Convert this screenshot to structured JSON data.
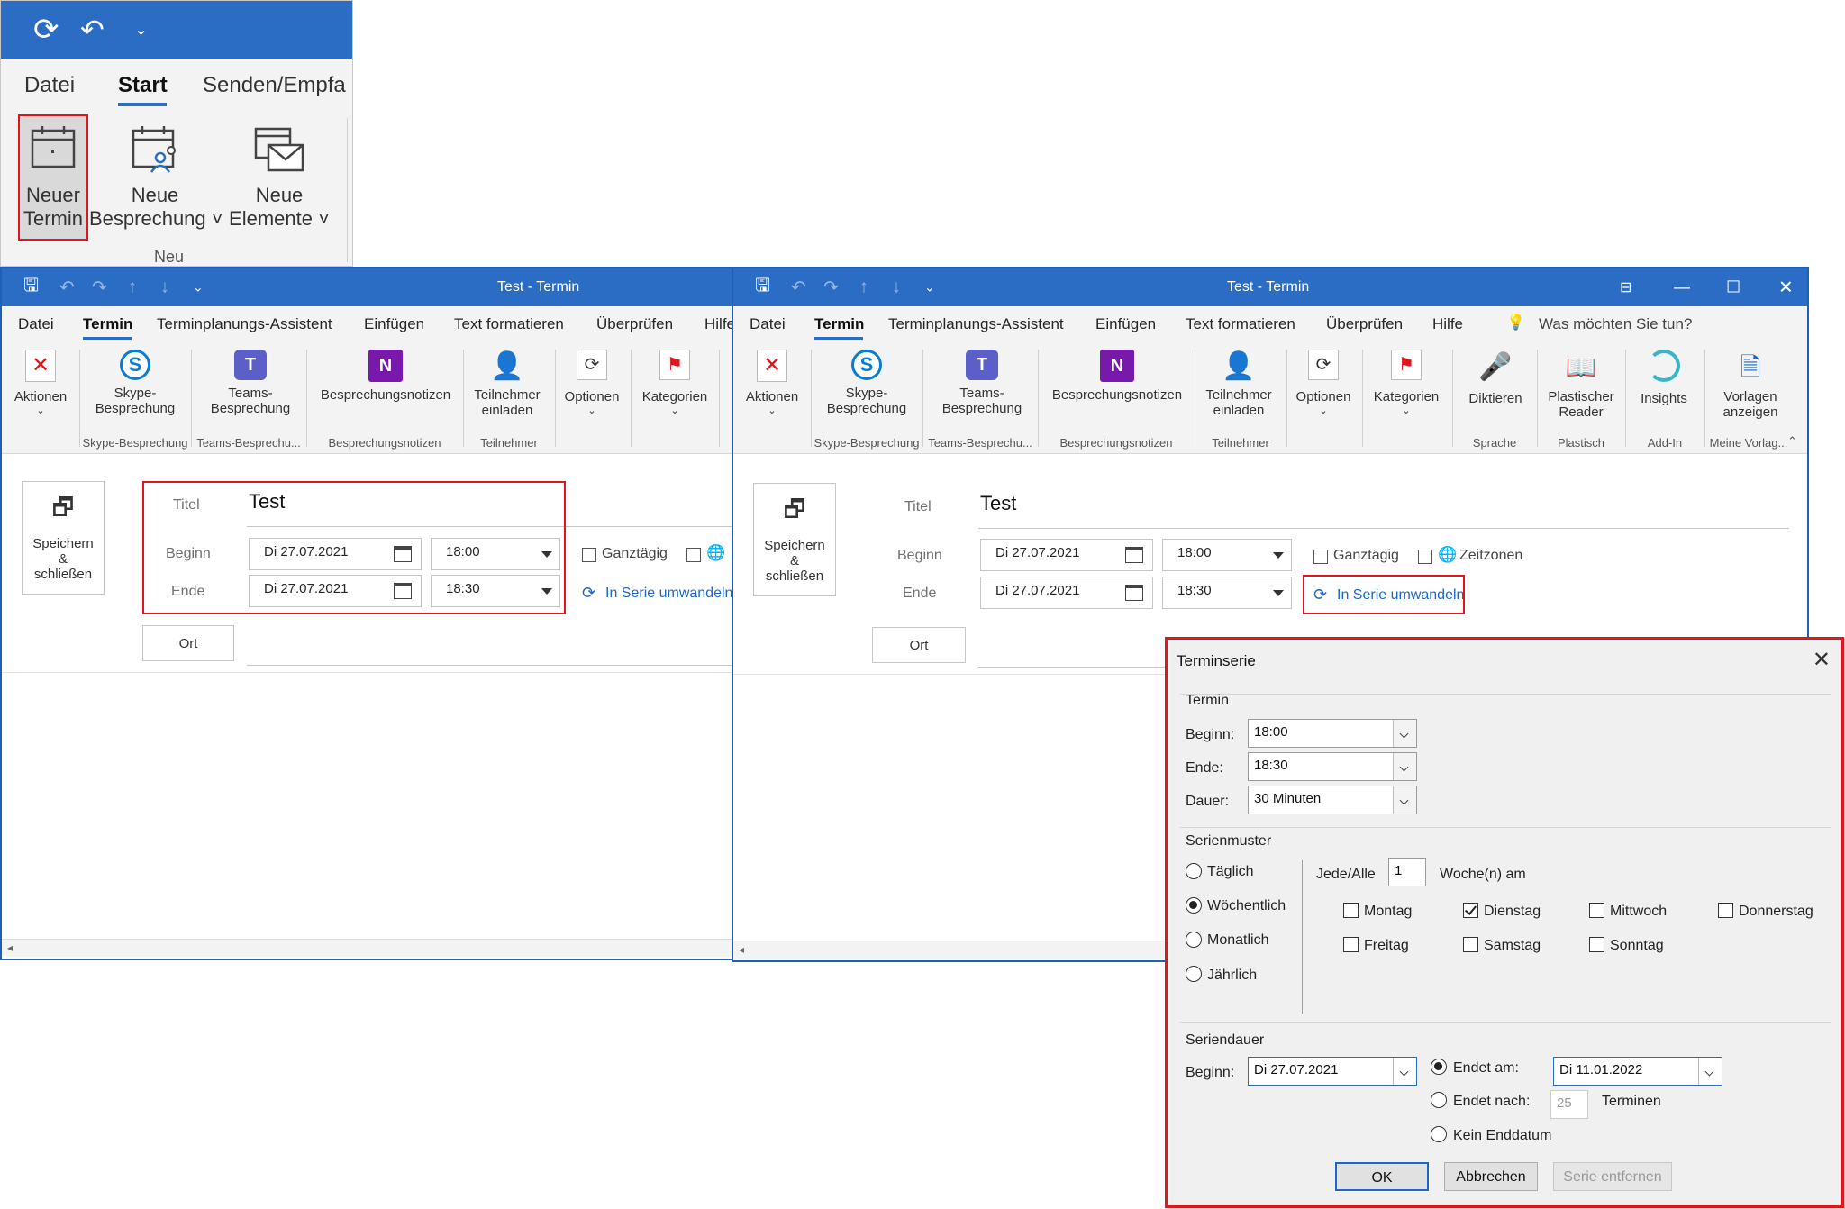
{
  "snippet": {
    "tabs": [
      "Datei",
      "Start",
      "Senden/Empfa"
    ],
    "buttons": [
      {
        "line1": "Neuer",
        "line2": "Termin"
      },
      {
        "line1": "Neue",
        "line2": "Besprechung ˅"
      },
      {
        "line1": "Neue",
        "line2": "Elemente ˅"
      }
    ],
    "group_label": "Neu"
  },
  "win1": {
    "title": "Test  -  Termin",
    "menu": [
      "Datei",
      "Termin",
      "Terminplanungs-Assistent",
      "Einfügen",
      "Text formatieren",
      "Überprüfen",
      "Hilfe"
    ],
    "ribbon": {
      "aktionen": "Aktionen",
      "skype": [
        "Skype-",
        "Besprechung"
      ],
      "teams": [
        "Teams-",
        "Besprechung"
      ],
      "notizen": "Besprechungsnotizen",
      "teilnehmer": [
        "Teilnehmer",
        "einladen"
      ],
      "optionen": "Optionen",
      "kategorien": "Kategorien",
      "groups": [
        "Skype-Besprechung",
        "Teams-Besprechu...",
        "Besprechungsnotizen",
        "Teilnehmer"
      ]
    },
    "save": [
      "Speichern",
      "&",
      "schließen"
    ],
    "form": {
      "titel_label": "Titel",
      "titel_value": "Test",
      "beginn_label": "Beginn",
      "ende_label": "Ende",
      "start_date": "Di 27.07.2021",
      "start_time": "18:00",
      "end_date": "Di 27.07.2021",
      "end_time": "18:30",
      "allday": "Ganztägig",
      "series_link": "In Serie umwandeln",
      "ort": "Ort"
    }
  },
  "win2": {
    "title": "Test  -  Termin",
    "menu": [
      "Datei",
      "Termin",
      "Terminplanungs-Assistent",
      "Einfügen",
      "Text formatieren",
      "Überprüfen",
      "Hilfe"
    ],
    "tellme": "Was möchten Sie tun?",
    "ribbon": {
      "aktionen": "Aktionen",
      "skype": [
        "Skype-",
        "Besprechung"
      ],
      "teams": [
        "Teams-",
        "Besprechung"
      ],
      "notizen": "Besprechungsnotizen",
      "teilnehmer": [
        "Teilnehmer",
        "einladen"
      ],
      "optionen": "Optionen",
      "kategorien": "Kategorien",
      "diktieren": "Diktieren",
      "reader": [
        "Plastischer",
        "Reader"
      ],
      "insights": "Insights",
      "vorlagen": [
        "Vorlagen",
        "anzeigen"
      ],
      "groups": [
        "Skype-Besprechung",
        "Teams-Besprechu...",
        "Besprechungsnotizen",
        "Teilnehmer",
        "Sprache",
        "Plastisch",
        "Add-In",
        "Meine Vorlag..."
      ]
    },
    "save": [
      "Speichern",
      "&",
      "schließen"
    ],
    "form": {
      "titel_label": "Titel",
      "titel_value": "Test",
      "beginn_label": "Beginn",
      "ende_label": "Ende",
      "start_date": "Di 27.07.2021",
      "start_time": "18:00",
      "end_date": "Di 27.07.2021",
      "end_time": "18:30",
      "allday": "Ganztägig",
      "timezones": "Zeitzonen",
      "series_link": "In Serie umwandeln",
      "ort": "Ort"
    }
  },
  "dialog": {
    "title": "Terminserie",
    "termin": {
      "legend": "Termin",
      "beginn_label": "Beginn:",
      "beginn": "18:00",
      "ende_label": "Ende:",
      "ende": "18:30",
      "dauer_label": "Dauer:",
      "dauer": "30 Minuten"
    },
    "muster": {
      "legend": "Serienmuster",
      "options": [
        "Täglich",
        "Wöchentlich",
        "Monatlich",
        "Jährlich"
      ],
      "selected": "Wöchentlich",
      "every_label": "Jede/Alle",
      "every_value": "1",
      "every_suffix": "Woche(n) am",
      "days": [
        {
          "label": "Montag",
          "checked": false
        },
        {
          "label": "Dienstag",
          "checked": true
        },
        {
          "label": "Mittwoch",
          "checked": false
        },
        {
          "label": "Donnerstag",
          "checked": false
        },
        {
          "label": "Freitag",
          "checked": false
        },
        {
          "label": "Samstag",
          "checked": false
        },
        {
          "label": "Sonntag",
          "checked": false
        }
      ]
    },
    "dauer": {
      "legend": "Seriendauer",
      "beginn_label": "Beginn:",
      "beginn": "Di 27.07.2021",
      "endet_am_label": "Endet am:",
      "endet_am": "Di 11.01.2022",
      "endet_nach_label": "Endet nach:",
      "endet_nach_value": "25",
      "terminen": "Terminen",
      "kein_enddatum": "Kein Enddatum",
      "selected": "Endet am:"
    },
    "buttons": {
      "ok": "OK",
      "cancel": "Abbrechen",
      "remove": "Serie entfernen"
    }
  },
  "colors": {
    "titlebar": "#2b6cc4",
    "accent": "#1e66c8",
    "highlight": "#e0161e"
  }
}
